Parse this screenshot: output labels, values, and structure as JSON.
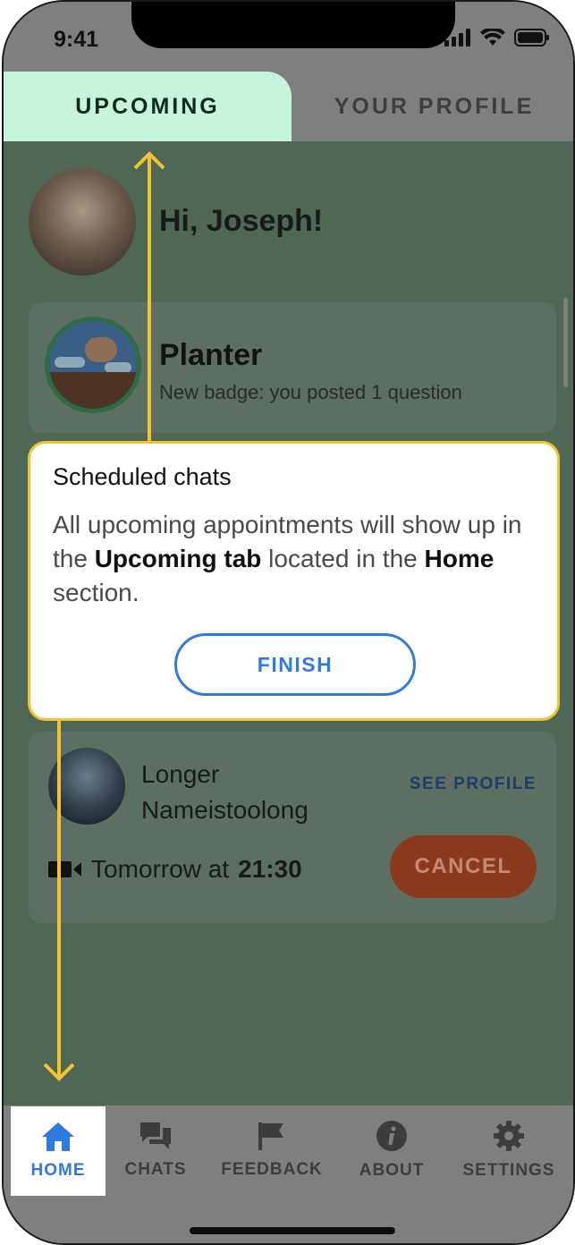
{
  "status_bar": {
    "time": "9:41"
  },
  "tabs": [
    {
      "label": "UPCOMING",
      "active": true
    },
    {
      "label": "YOUR PROFILE",
      "active": false
    }
  ],
  "greeting": "Hi, Joseph!",
  "badge": {
    "title": "Planter",
    "subtitle": "New badge: you posted 1 question"
  },
  "tooltip": {
    "title": "Scheduled chats",
    "body_start": "All upcoming appointments will show up in the ",
    "body_bold1": "Upcoming tab",
    "body_mid": " located in the ",
    "body_bold2": "Home",
    "body_end": " section.",
    "button": "FINISH"
  },
  "appointment": {
    "name": "Longer Nameistoolong",
    "see_profile": "SEE PROFILE",
    "when_prefix": "Tomorrow at",
    "when_time": "21:30",
    "cancel": "CANCEL"
  },
  "bottom_nav": [
    {
      "label": "HOME",
      "icon": "home-icon",
      "active": true
    },
    {
      "label": "CHATS",
      "icon": "chat-icon",
      "active": false
    },
    {
      "label": "FEEDBACK",
      "icon": "flag-icon",
      "active": false
    },
    {
      "label": "ABOUT",
      "icon": "info-icon",
      "active": false
    },
    {
      "label": "SETTINGS",
      "icon": "gear-icon",
      "active": false
    }
  ],
  "colors": {
    "accent_blue": "#2f7adf",
    "highlight_yellow": "#f2c230",
    "active_tab": "#c6f4dc",
    "cancel_red": "#8a3a1d"
  }
}
